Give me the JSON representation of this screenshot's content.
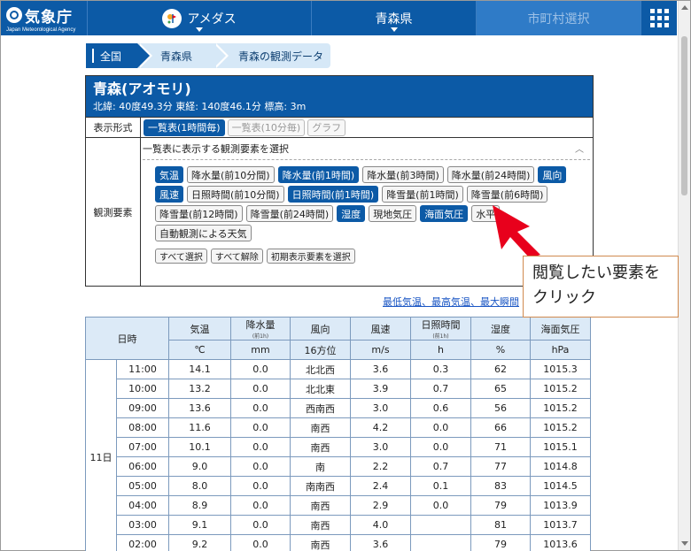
{
  "nav": {
    "logo_title": "気象庁",
    "logo_subtitle": "Japan Meteorological Agency",
    "amedas_label": "アメダス",
    "pref_label": "青森県",
    "city_label": "市町村選択"
  },
  "breadcrumb": [
    "全国",
    "青森県",
    "青森の観測データ"
  ],
  "station": {
    "name": "青森(アオモリ)",
    "coords": "北緯: 40度49.3分 東経: 140度46.1分 標高: 3m",
    "format_label": "表示形式",
    "format_buttons": [
      "一覧表(1時間毎)",
      "一覧表(10分毎)",
      "グラフ"
    ],
    "elements_label": "観測要素",
    "elements_title": "一覧表に表示する観測要素を選択",
    "chips": [
      {
        "label": "気温",
        "state": "on"
      },
      {
        "label": "降水量(前10分間)",
        "state": "off"
      },
      {
        "label": "降水量(前1時間)",
        "state": "on"
      },
      {
        "label": "降水量(前3時間)",
        "state": "off"
      },
      {
        "label": "降水量(前24時間)",
        "state": "off"
      },
      {
        "label": "風向",
        "state": "on"
      },
      {
        "label": "風速",
        "state": "on"
      },
      {
        "label": "日照時間(前10分間)",
        "state": "off"
      },
      {
        "label": "日照時間(前1時間)",
        "state": "on"
      },
      {
        "label": "降雪量(前1時間)",
        "state": "off"
      },
      {
        "label": "降雪量(前6時間)",
        "state": "off"
      },
      {
        "label": "降雪量(前12時間)",
        "state": "off"
      },
      {
        "label": "降雪量(前24時間)",
        "state": "off"
      },
      {
        "label": "湿度",
        "state": "on"
      },
      {
        "label": "現地気圧",
        "state": "off"
      },
      {
        "label": "海面気圧",
        "state": "on"
      },
      {
        "label": "水平",
        "state": "off"
      },
      {
        "label": "自動観測による天気",
        "state": "off"
      }
    ],
    "reset_buttons": [
      "すべて選択",
      "すべて解除",
      "初期表示要素を選択"
    ]
  },
  "callout": "閲覧したい要素をクリック",
  "links_text": "最低気温、最高気温、最大瞬間",
  "table": {
    "headers": [
      {
        "label": "日時",
        "sub": ""
      },
      {
        "label": "気温",
        "sub": ""
      },
      {
        "label": "降水量",
        "sub": "(前1h)"
      },
      {
        "label": "風向",
        "sub": ""
      },
      {
        "label": "風速",
        "sub": ""
      },
      {
        "label": "日照時間",
        "sub": "(前1h)"
      },
      {
        "label": "湿度",
        "sub": ""
      },
      {
        "label": "海面気圧",
        "sub": ""
      }
    ],
    "units": [
      "℃",
      "mm",
      "16方位",
      "m/s",
      "h",
      "%",
      "hPa"
    ],
    "day": "11日",
    "rows": [
      [
        "11:00",
        "14.1",
        "0.0",
        "北北西",
        "3.6",
        "0.3",
        "62",
        "1015.3"
      ],
      [
        "10:00",
        "13.2",
        "0.0",
        "北北東",
        "3.9",
        "0.7",
        "65",
        "1015.2"
      ],
      [
        "09:00",
        "13.6",
        "0.0",
        "西南西",
        "3.0",
        "0.6",
        "56",
        "1015.2"
      ],
      [
        "08:00",
        "11.6",
        "0.0",
        "南西",
        "4.2",
        "0.0",
        "66",
        "1015.2"
      ],
      [
        "07:00",
        "10.1",
        "0.0",
        "南西",
        "3.0",
        "0.0",
        "71",
        "1015.1"
      ],
      [
        "06:00",
        "9.0",
        "0.0",
        "南",
        "2.2",
        "0.7",
        "77",
        "1014.8"
      ],
      [
        "05:00",
        "8.0",
        "0.0",
        "南南西",
        "2.4",
        "0.1",
        "83",
        "1014.5"
      ],
      [
        "04:00",
        "8.9",
        "0.0",
        "南西",
        "2.9",
        "0.0",
        "79",
        "1013.9"
      ],
      [
        "03:00",
        "9.1",
        "0.0",
        "南西",
        "4.0",
        "",
        "81",
        "1013.7"
      ],
      [
        "02:00",
        "9.2",
        "0.0",
        "南西",
        "3.6",
        "",
        "79",
        "1013.6"
      ]
    ]
  },
  "colors": {
    "brand": "#0c5aa6",
    "accent_red": "#e8001c",
    "callout_border": "#d08a4f"
  }
}
